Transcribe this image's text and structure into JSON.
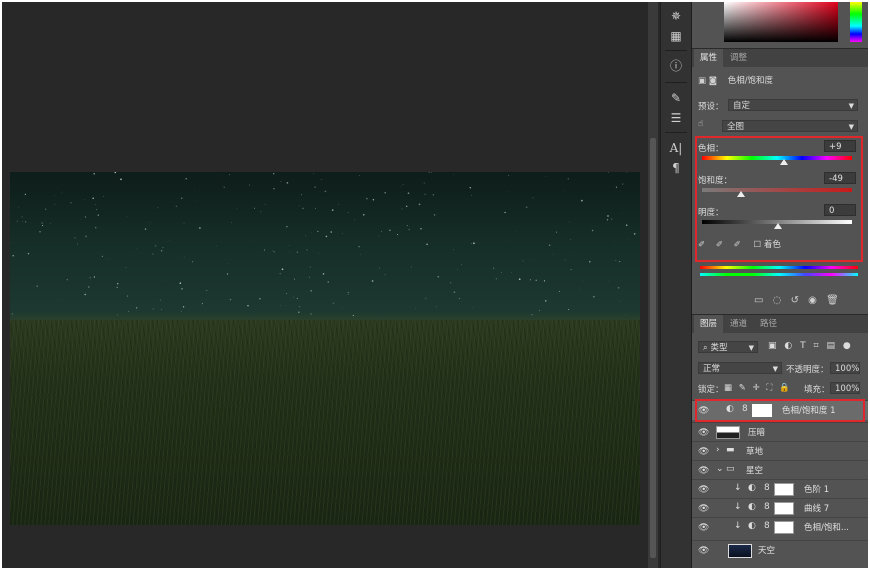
{
  "properties_panel": {
    "tabs": [
      "属性",
      "调整"
    ],
    "layer_type": "色相/饱和度",
    "preset_label": "预设：",
    "preset_value": "自定",
    "channel_value": "全图",
    "hue_label": "色相：",
    "hue_value": "+9",
    "saturation_label": "饱和度：",
    "saturation_value": "-49",
    "lightness_label": "明度：",
    "lightness_value": "0",
    "colorize_label": "着色"
  },
  "layers_panel": {
    "tabs": [
      "图层",
      "通道",
      "路径"
    ],
    "filter_label": "类型",
    "blend_mode": "正常",
    "opacity_label": "不透明度：",
    "opacity_value": "100%",
    "lock_label": "锁定：",
    "fill_label": "填充：",
    "fill_value": "100%",
    "layers": [
      {
        "name": "色相/饱和度 1"
      },
      {
        "name": "压暗"
      },
      {
        "name": "草地"
      },
      {
        "name": "星空"
      },
      {
        "name": "色阶 1"
      },
      {
        "name": "曲线 7"
      },
      {
        "name": "色相/饱和..."
      },
      {
        "name": "天空"
      }
    ]
  },
  "colors": {
    "highlight": "#e0282c",
    "panel_bg": "#535353",
    "workspace_bg": "#282828"
  }
}
